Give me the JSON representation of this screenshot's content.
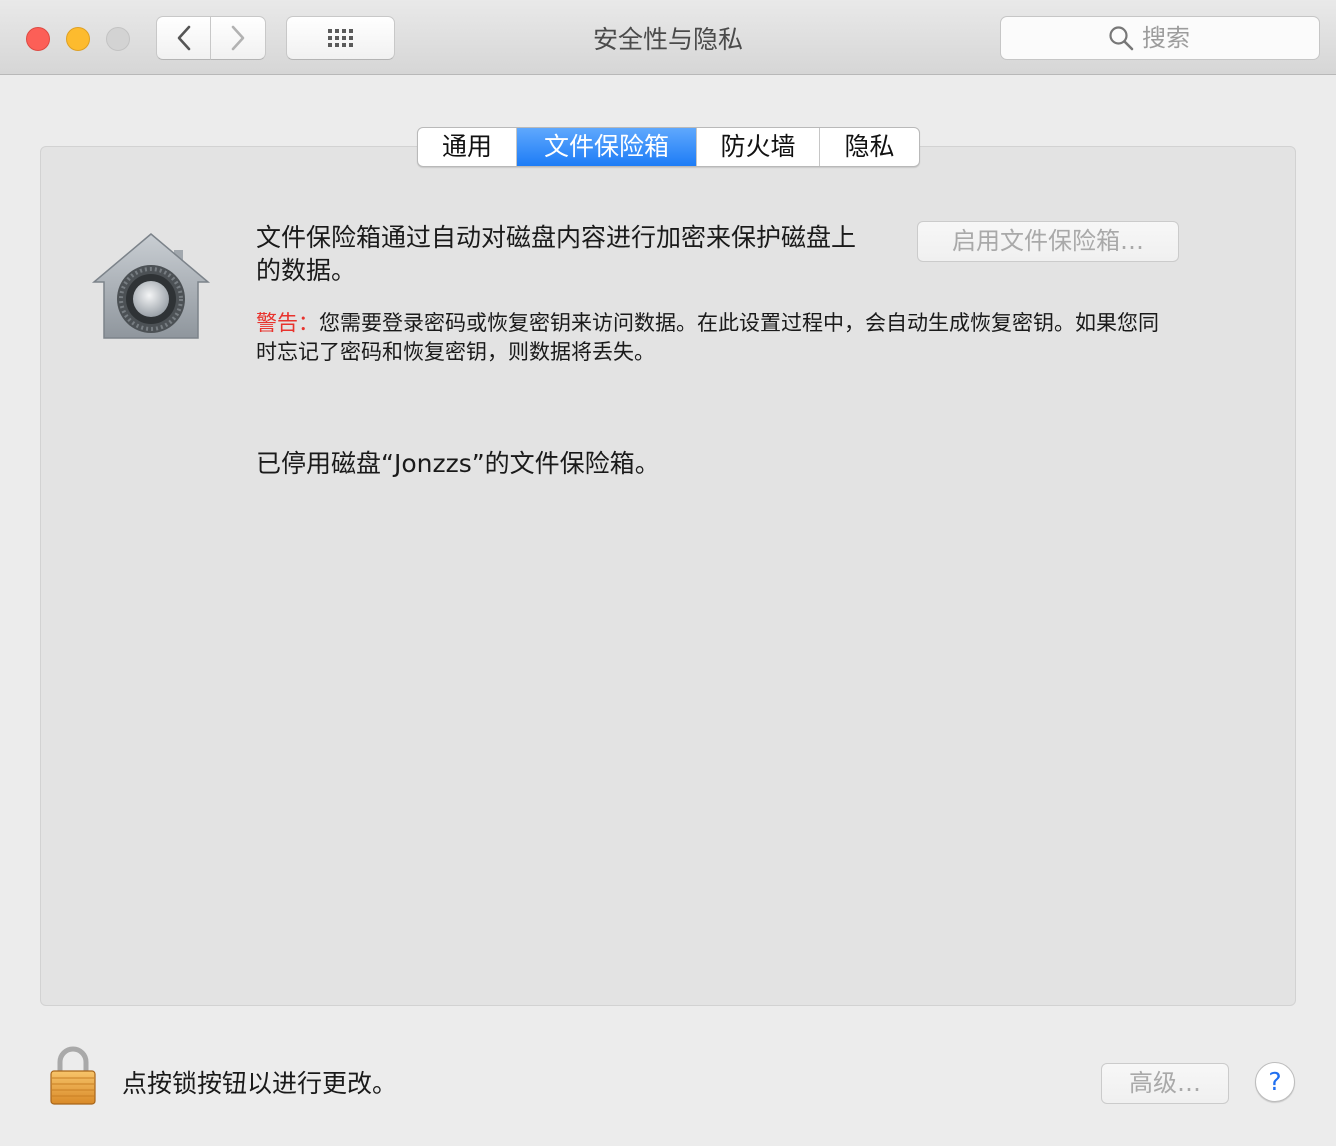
{
  "window": {
    "title": "安全性与隐私",
    "search_placeholder": "搜索"
  },
  "toolbar": {
    "back_icon": "chevron-left-icon",
    "forward_icon": "chevron-right-icon",
    "show_all_icon": "grid-icon"
  },
  "tabs": [
    {
      "label": "通用",
      "active": false
    },
    {
      "label": "文件保险箱",
      "active": true
    },
    {
      "label": "防火墙",
      "active": false
    },
    {
      "label": "隐私",
      "active": false
    }
  ],
  "filevault": {
    "icon": "filevault-icon",
    "description": "文件保险箱通过自动对磁盘内容进行加密来保护磁盘上的数据。",
    "warning_label": "警告：",
    "warning_text": "您需要登录密码或恢复密钥来访问数据。在此设置过程中，会自动生成恢复密钥。如果您同时忘记了密码和恢复密钥，则数据将丢失。",
    "status": "已停用磁盘“Jonzzs”的文件保险箱。",
    "enable_button": "启用文件保险箱…"
  },
  "footer": {
    "lock_icon": "lock-icon",
    "lock_text": "点按锁按钮以进行更改。",
    "advanced_button": "高级…",
    "help_button": "?"
  },
  "colors": {
    "accent": "#1d7cf6",
    "warning": "#e8332d",
    "close": "#fc5f57",
    "minimize": "#fdbb2e"
  }
}
